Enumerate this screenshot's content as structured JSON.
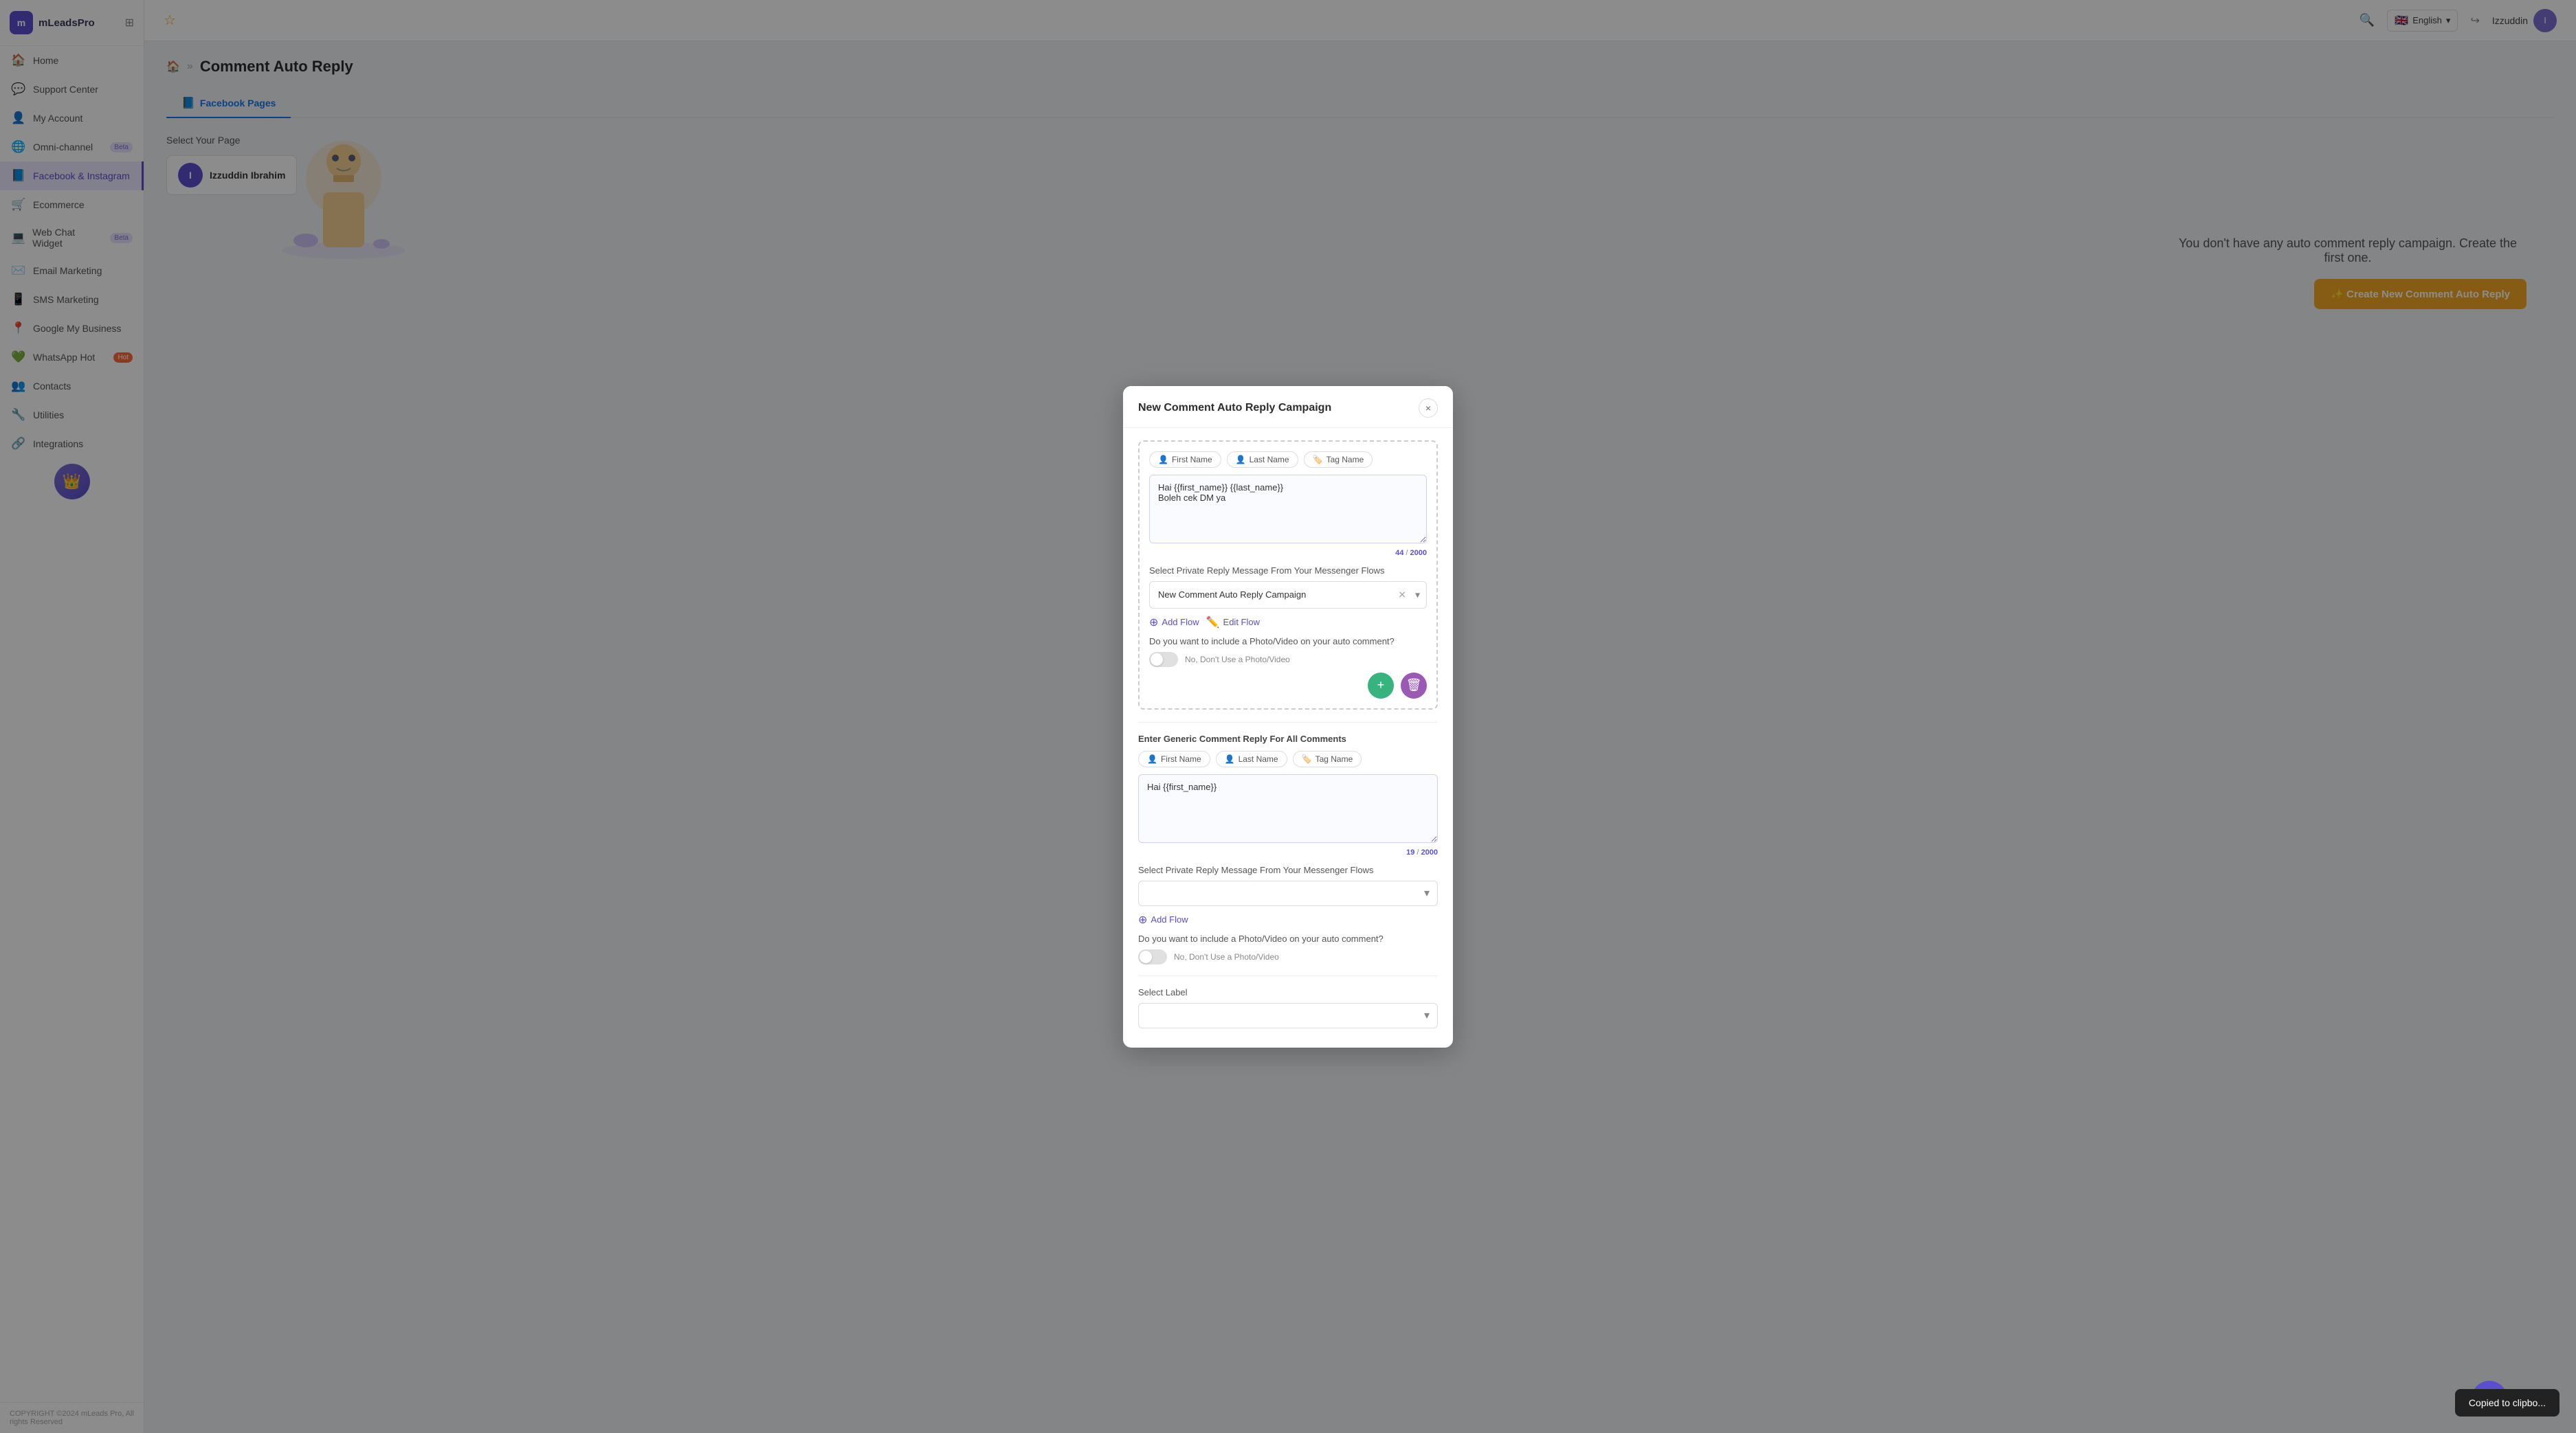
{
  "app": {
    "name": "mLeadsPro",
    "logo_text": "mLeadsPro"
  },
  "topbar": {
    "user": "Izzuddin",
    "language": "English",
    "flag": "🇬🇧"
  },
  "sidebar": {
    "items": [
      {
        "id": "home",
        "label": "Home",
        "icon": "🏠",
        "badge": null
      },
      {
        "id": "support",
        "label": "Support Center",
        "icon": "💬",
        "badge": null
      },
      {
        "id": "myaccount",
        "label": "My Account",
        "icon": "👤",
        "badge": null
      },
      {
        "id": "omni",
        "label": "Omni-channel",
        "icon": "🌐",
        "badge": "Beta"
      },
      {
        "id": "fb",
        "label": "Facebook & Instagram",
        "icon": "📘",
        "badge": null,
        "active": true
      },
      {
        "id": "ecommerce",
        "label": "Ecommerce",
        "icon": "🛒",
        "badge": null
      },
      {
        "id": "webchat",
        "label": "Web Chat Widget",
        "icon": "💻",
        "badge": "Beta"
      },
      {
        "id": "email",
        "label": "Email Marketing",
        "icon": "✉️",
        "badge": null
      },
      {
        "id": "sms",
        "label": "SMS Marketing",
        "icon": "📱",
        "badge": null
      },
      {
        "id": "gmb",
        "label": "Google My Business",
        "icon": "📍",
        "badge": null
      },
      {
        "id": "whatsapp",
        "label": "WhatsApp Hot",
        "icon": "💚",
        "badge": "Hot"
      },
      {
        "id": "contacts",
        "label": "Contacts",
        "icon": "👥",
        "badge": null
      },
      {
        "id": "utilities",
        "label": "Utilities",
        "icon": "🔧",
        "badge": null
      },
      {
        "id": "integrations",
        "label": "Integrations",
        "icon": "🔗",
        "badge": null
      }
    ],
    "footer": "COPYRIGHT ©2024 mLeads Pro, All rights Reserved"
  },
  "page": {
    "title": "Comment Auto Reply",
    "breadcrumb_icon": "🏠",
    "tabs": [
      {
        "id": "fb_pages",
        "label": "Facebook Pages",
        "icon": "📘",
        "active": true
      }
    ],
    "select_page_label": "Select Your Page",
    "page_card": {
      "name": "Izzuddin Ibrahim",
      "initials": "I"
    }
  },
  "empty_state": {
    "text": "ve any auto comment reply campaign. Create the first one.",
    "create_btn": "✨ Create New Comment Auto Reply"
  },
  "modal": {
    "title": "New Comment Auto Reply Campaign",
    "close_label": "×",
    "section1": {
      "tags": [
        {
          "label": "First Name",
          "icon": "👤"
        },
        {
          "label": "Last Name",
          "icon": "👤"
        },
        {
          "label": "Tag Name",
          "icon": "🏷️"
        }
      ],
      "message": "Hai {{first_name}} {{last_name}}\nBoleh cek DM ya",
      "char_count": "44",
      "char_max": "2000",
      "private_reply_label": "Select Private Reply Message From Your Messenger Flows",
      "private_reply_value": "New Comment Auto Reply Campaign",
      "add_flow_label": "Add Flow",
      "edit_flow_label": "Edit Flow",
      "photo_question": "Do you want to include a Photo/Video on your auto comment?",
      "photo_toggle_label": "No, Don't Use a Photo/Video"
    },
    "section2": {
      "label": "Enter Generic Comment Reply For All Comments",
      "tags": [
        {
          "label": "First Name",
          "icon": "👤"
        },
        {
          "label": "Last Name",
          "icon": "👤"
        },
        {
          "label": "Tag Name",
          "icon": "🏷️"
        }
      ],
      "message": "Hai {{first_name}}",
      "char_count": "19",
      "char_max": "2000",
      "private_reply_label": "Select Private Reply Message From Your Messenger Flows",
      "add_flow_label": "Add Flow",
      "photo_question": "Do you want to include a Photo/Video on your auto comment?",
      "photo_toggle_label": "No, Don't Use a Photo/Video"
    },
    "select_label": {
      "label": "Select Label",
      "placeholder": ""
    }
  },
  "toast": {
    "message": "Copied to clipbo..."
  }
}
